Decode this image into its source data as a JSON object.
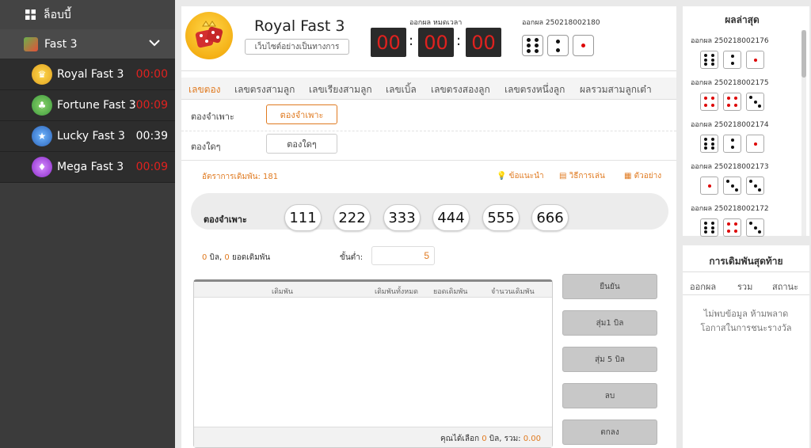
{
  "sidebar": {
    "lobby_label": "ล็อบบี้",
    "category_label": "Fast 3",
    "games": [
      {
        "name": "Royal Fast 3",
        "time": "00:00",
        "color": "#e0221f",
        "icon_color": "#e0a020"
      },
      {
        "name": "Fortune Fast 3",
        "time": "00:09",
        "color": "#e0221f",
        "icon_color": "#4caf50"
      },
      {
        "name": "Lucky Fast 3",
        "time": "00:39",
        "color": "#ffffff",
        "icon_color": "#3a7bd5"
      },
      {
        "name": "Mega Fast 3",
        "time": "00:09",
        "color": "#e0221f",
        "icon_color": "#a03ad5"
      }
    ]
  },
  "header": {
    "title": "Royal Fast 3",
    "subtitle": "เว็บไซต์อย่างเป็นทางการ",
    "countdown_label": "ออกผล หมดเวลา",
    "countdown": [
      "00",
      "00",
      "00"
    ],
    "result_label": "ออกผล 250218002180",
    "result_dice": [
      6,
      2,
      1
    ]
  },
  "tabs": [
    "เลขตอง",
    "เลขตรงสามลูก",
    "เลขเรียงสามลูก",
    "เลขเบิ้ล",
    "เลขตรงสองลูก",
    "เลขตรงหนึ่งลูก",
    "ผลรวมสามลูกเต๋า"
  ],
  "options": {
    "row1_label": "ตองจำเพาะ",
    "row1_btn": "ตองจำเพาะ",
    "row2_label": "ตองใดๆ",
    "row2_btn": "ตองใดๆ"
  },
  "bet_rate": "อัตราการเดิมพัน: 181",
  "links": {
    "tips": "ข้อแนะนำ",
    "howto": "วิธีการเล่น",
    "example": "ตัวอย่าง"
  },
  "numbers": {
    "label": "ตองจำเพาะ",
    "values": [
      "111",
      "222",
      "333",
      "444",
      "555",
      "666"
    ]
  },
  "summary": {
    "bills": "0",
    "bills_text": " บิล, ",
    "bets": "0",
    "bets_text": " ยอดเดิมพัน",
    "min_label": "ขั้นต่ำ:",
    "min_value": "5"
  },
  "table": {
    "headers": [
      "เดิมพัน",
      "เดิมพันทั้งหมด",
      "ยอดเดิมพัน",
      "จำนวนเดิมพัน"
    ],
    "footer_pre": "คุณได้เลือก ",
    "footer_bills": "0",
    "footer_mid": " บิล, รวม: ",
    "footer_total": "0.00"
  },
  "actions": [
    "ยืนยัน",
    "สุ่ม1 บิล",
    "สุ่ม 5 บิล",
    "ลบ",
    "ตกลง"
  ],
  "latest": {
    "title": "ผลล่าสุด",
    "rounds": [
      {
        "label": "ออกผล 250218002176",
        "dice": [
          6,
          2,
          1
        ]
      },
      {
        "label": "ออกผล 250218002175",
        "dice": [
          4,
          4,
          3
        ]
      },
      {
        "label": "ออกผล 250218002174",
        "dice": [
          6,
          2,
          1
        ]
      },
      {
        "label": "ออกผล 250218002173",
        "dice": [
          1,
          3,
          3
        ]
      },
      {
        "label": "ออกผล 250218002172",
        "dice": [
          6,
          4,
          3
        ]
      }
    ]
  },
  "last_bet": {
    "title": "การเดิมพันสุดท้าย",
    "headers": [
      "ออกผล",
      "รวม",
      "สถานะ"
    ],
    "empty_line1": "ไม่พบข้อมูล ห้ามพลาด",
    "empty_line2": "โอกาสในการชนะรางวัล"
  }
}
